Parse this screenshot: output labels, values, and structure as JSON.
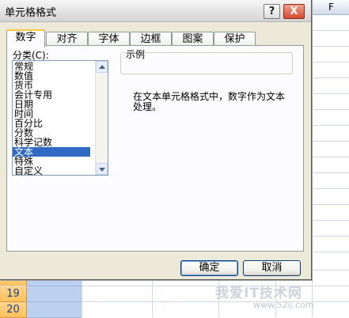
{
  "dialog": {
    "title": "单元格格式",
    "help_button": "?",
    "close_button": "X",
    "tabs": [
      {
        "label": "数字",
        "active": true
      },
      {
        "label": "对齐",
        "active": false
      },
      {
        "label": "字体",
        "active": false
      },
      {
        "label": "边框",
        "active": false
      },
      {
        "label": "图案",
        "active": false
      },
      {
        "label": "保护",
        "active": false
      }
    ],
    "category_label": "分类(C):",
    "categories": [
      "常规",
      "数值",
      "货币",
      "会计专用",
      "日期",
      "时间",
      "百分比",
      "分数",
      "科学记数",
      "文本",
      "特殊",
      "自定义"
    ],
    "selected_category": "文本",
    "sample_label": "示例",
    "description": "在文本单元格格式中，数字作为文本处理。",
    "ok_button": "确定",
    "cancel_button": "取消"
  },
  "sheet": {
    "column_header": "F",
    "row_numbers": [
      "19",
      "20"
    ]
  },
  "watermark": {
    "text": "我爱IT技术网",
    "url": "www.52ij.com"
  },
  "colors": {
    "selection": "#316ac5",
    "row_header": "#ffbf58",
    "dialog_bg": "#ece9d8"
  }
}
